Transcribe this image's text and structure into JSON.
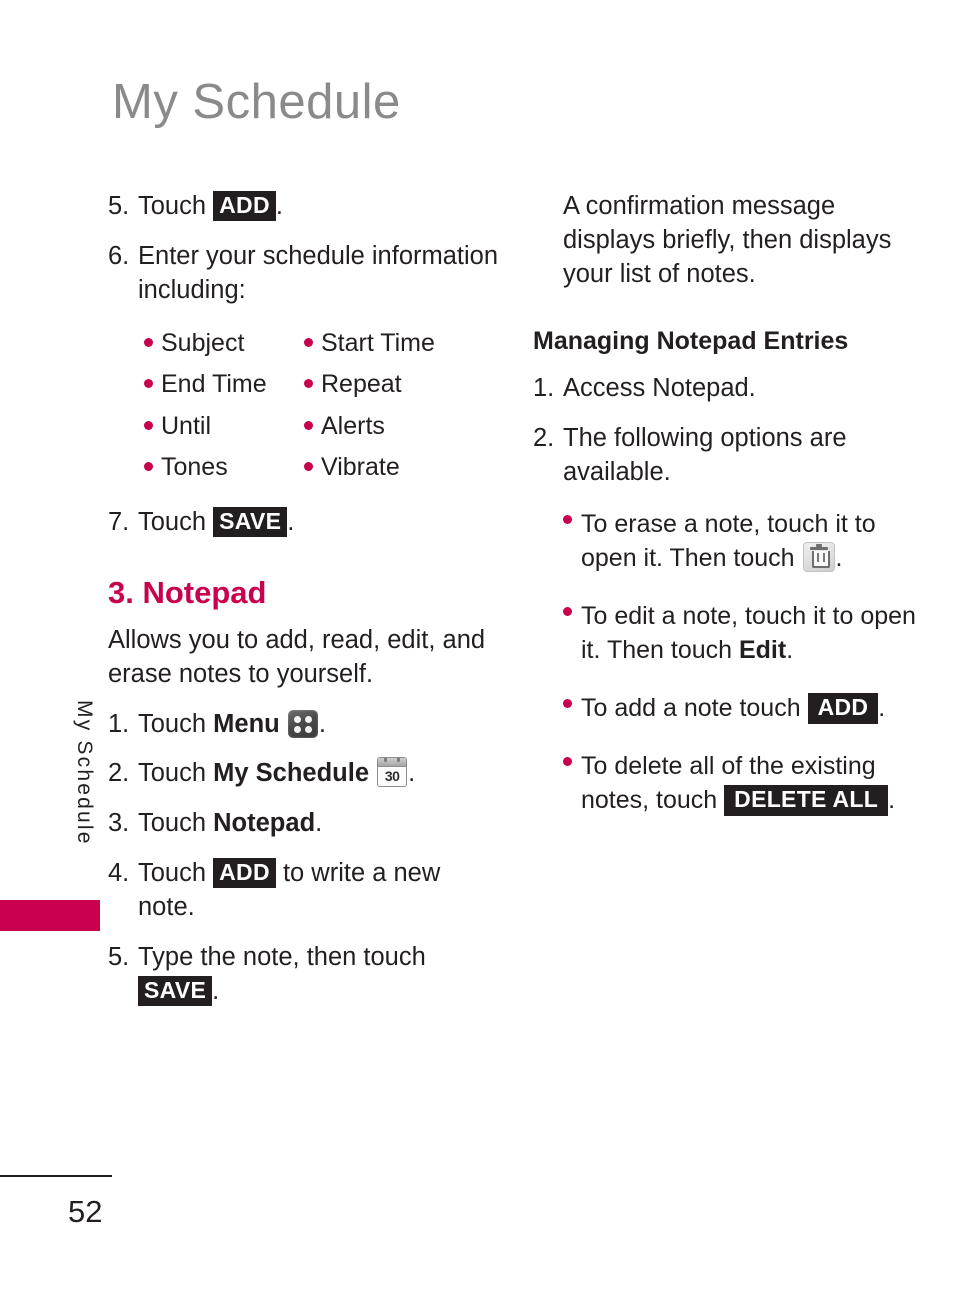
{
  "page": {
    "title": "My Schedule",
    "side_tab_label": "My Schedule",
    "page_number": "52",
    "accent_color": "#c8004e",
    "title_color": "#8a8a8d",
    "text_color": "#231f20"
  },
  "left_column": {
    "step5": {
      "num": "5.",
      "text_before": "Touch ",
      "key": "ADD",
      "text_after": "."
    },
    "step6": {
      "num": "6.",
      "text": "Enter your schedule information including:"
    },
    "options": [
      {
        "col1": "Subject",
        "col2": "Start Time"
      },
      {
        "col1": "End Time",
        "col2": "Repeat"
      },
      {
        "col1": "Until",
        "col2": "Alerts"
      },
      {
        "col1": "Tones",
        "col2": "Vibrate"
      }
    ],
    "step7": {
      "num": "7.",
      "text_before": "Touch ",
      "key": "SAVE",
      "text_after": "."
    },
    "notepad_heading": "3. Notepad",
    "notepad_intro": "Allows you to add, read, edit, and erase notes to yourself.",
    "notepad_steps": {
      "s1": {
        "num": "1.",
        "before": "Touch ",
        "bold": "Menu",
        "icon": "menu-grid-icon",
        "after": "."
      },
      "s2": {
        "num": "2.",
        "before": "Touch ",
        "bold": "My Schedule",
        "icon": "calendar-30-icon",
        "after": "."
      },
      "s3": {
        "num": "3.",
        "before": "Touch ",
        "bold": "Notepad",
        "after": "."
      },
      "s4": {
        "num": "4.",
        "before": "Touch ",
        "key": "ADD",
        "after": " to write a new note."
      },
      "s5": {
        "num": "5.",
        "before": "Type the note, then touch ",
        "key": "SAVE",
        "after": "."
      }
    }
  },
  "right_column": {
    "confirmation": "A confirmation message displays briefly, then displays your list of notes.",
    "managing_heading": "Managing Notepad Entries",
    "step1": {
      "num": "1.",
      "text": "Access Notepad."
    },
    "step2": {
      "num": "2.",
      "text": "The following options are available."
    },
    "bullets": {
      "b1": {
        "before": "To erase a note, touch it to open it. Then touch ",
        "icon": "trash-can-icon",
        "after": "."
      },
      "b2": {
        "before": "To edit a note, touch it to open it. Then touch ",
        "bold": "Edit",
        "after": "."
      },
      "b3": {
        "before": "To add a note touch ",
        "key": "ADD",
        "after": "."
      },
      "b4": {
        "before": "To delete all of the existing notes, touch ",
        "key": "DELETE ALL",
        "after": "."
      }
    }
  }
}
